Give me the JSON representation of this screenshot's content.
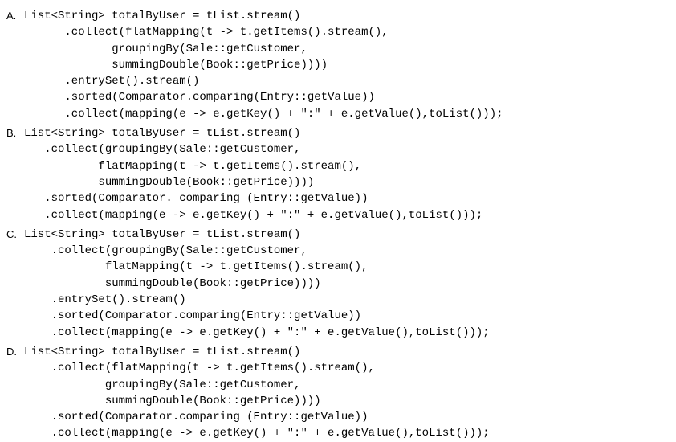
{
  "options": [
    {
      "bullet": "A.",
      "lines": [
        "List<String> totalByUser = tList.stream()",
        "      .collect(flatMapping(t -> t.getItems().stream(),",
        "             groupingBy(Sale::getCustomer,",
        "             summingDouble(Book::getPrice))))",
        "      .entrySet().stream()",
        "      .sorted(Comparator.comparing(Entry::getValue))",
        "      .collect(mapping(e -> e.getKey() + \":\" + e.getValue(),toList()));"
      ]
    },
    {
      "bullet": "B.",
      "lines": [
        "List<String> totalByUser = tList.stream()",
        "   .collect(groupingBy(Sale::getCustomer,",
        "           flatMapping(t -> t.getItems().stream(),",
        "           summingDouble(Book::getPrice))))",
        "   .sorted(Comparator. comparing (Entry::getValue))",
        "   .collect(mapping(e -> e.getKey() + \":\" + e.getValue(),toList()));"
      ]
    },
    {
      "bullet": "C.",
      "lines": [
        "List<String> totalByUser = tList.stream()",
        "    .collect(groupingBy(Sale::getCustomer,",
        "            flatMapping(t -> t.getItems().stream(),",
        "            summingDouble(Book::getPrice))))",
        "    .entrySet().stream()",
        "    .sorted(Comparator.comparing(Entry::getValue))",
        "    .collect(mapping(e -> e.getKey() + \":\" + e.getValue(),toList()));"
      ]
    },
    {
      "bullet": "D.",
      "lines": [
        "List<String> totalByUser = tList.stream()",
        "    .collect(flatMapping(t -> t.getItems().stream(),",
        "            groupingBy(Sale::getCustomer,",
        "            summingDouble(Book::getPrice))))",
        "    .sorted(Comparator.comparing (Entry::getValue))",
        "    .collect(mapping(e -> e.getKey() + \":\" + e.getValue(),toList()));"
      ]
    }
  ]
}
